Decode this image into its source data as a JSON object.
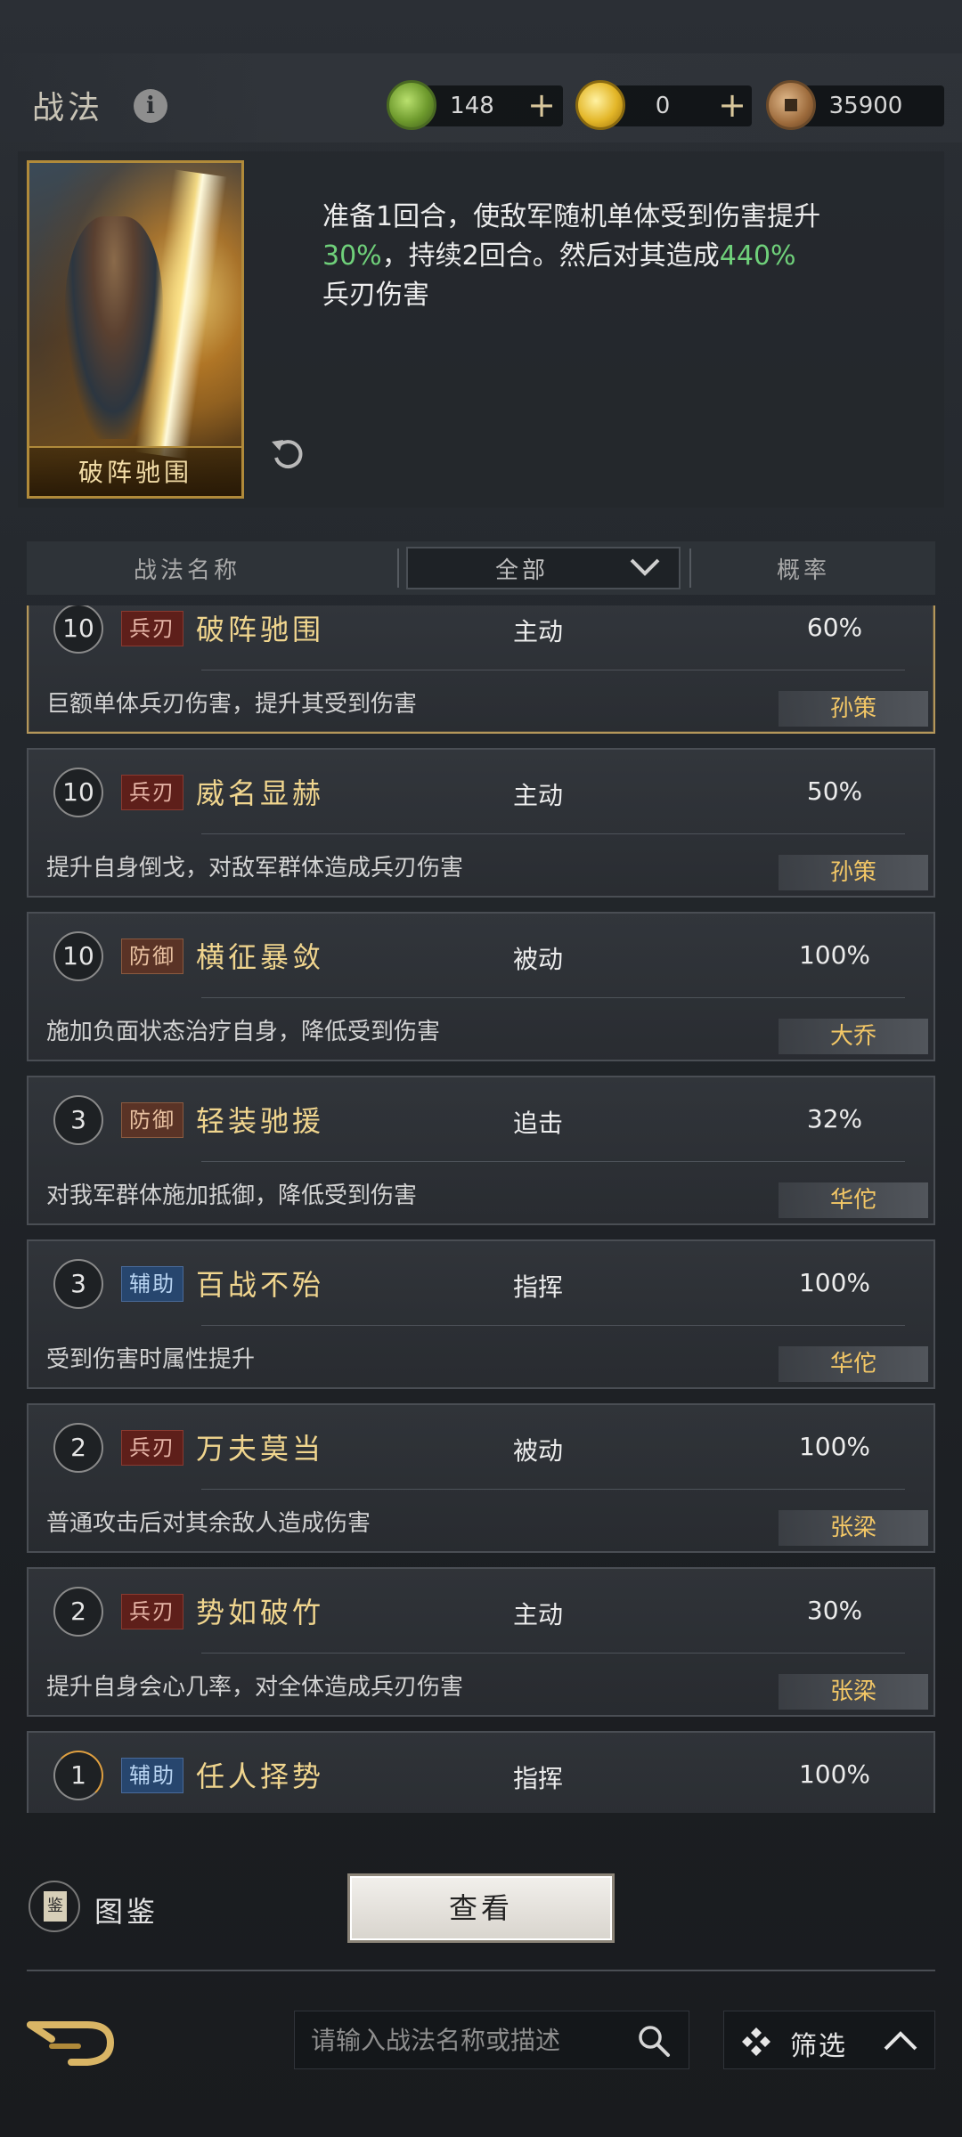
{
  "header": {
    "title": "战法",
    "resources": [
      {
        "icon": "jade-icon",
        "value": "148"
      },
      {
        "icon": "gold-ingot-icon",
        "value": "0"
      },
      {
        "icon": "copper-coin-icon",
        "value": "35900"
      }
    ],
    "plus": "+"
  },
  "preview": {
    "card_name": "破阵驰围",
    "desc_part1": "准备1回合，使敌军随机单体受到伤害提升",
    "desc_hl1": "30%",
    "desc_part2": "，持续2回合。然后对其造成",
    "desc_hl2": "440%",
    "desc_part3": "兵刃伤害"
  },
  "list_header": {
    "name_col": "战法名称",
    "filter_value": "全部",
    "rate_col": "概率"
  },
  "skills": [
    {
      "level": "10",
      "tag": "兵刃",
      "name": "破阵驰围",
      "type": "主动",
      "rate": "60%",
      "desc": "巨额单体兵刃伤害，提升其受到伤害",
      "owner": "孙策"
    },
    {
      "level": "10",
      "tag": "兵刃",
      "name": "威名显赫",
      "type": "主动",
      "rate": "50%",
      "desc": "提升自身倒戈，对敌军群体造成兵刃伤害",
      "owner": "孙策"
    },
    {
      "level": "10",
      "tag": "防御",
      "name": "横征暴敛",
      "type": "被动",
      "rate": "100%",
      "desc": "施加负面状态治疗自身，降低受到伤害",
      "owner": "大乔"
    },
    {
      "level": "3",
      "tag": "防御",
      "name": "轻装驰援",
      "type": "追击",
      "rate": "32%",
      "desc": "对我军群体施加抵御，降低受到伤害",
      "owner": "华佗"
    },
    {
      "level": "3",
      "tag": "辅助",
      "name": "百战不殆",
      "type": "指挥",
      "rate": "100%",
      "desc": "受到伤害时属性提升",
      "owner": "华佗"
    },
    {
      "level": "2",
      "tag": "兵刃",
      "name": "万夫莫当",
      "type": "被动",
      "rate": "100%",
      "desc": "普通攻击后对其余敌人造成伤害",
      "owner": "张梁"
    },
    {
      "level": "2",
      "tag": "兵刃",
      "name": "势如破竹",
      "type": "主动",
      "rate": "30%",
      "desc": "提升自身会心几率，对全体造成兵刃伤害",
      "owner": "张梁"
    },
    {
      "level": "1",
      "tag": "辅助",
      "name": "任人择势",
      "type": "指挥",
      "rate": "100%",
      "desc": "",
      "owner": ""
    }
  ],
  "bottom": {
    "atlas_icon_char": "鉴",
    "atlas_label": "图鉴",
    "view_button": "查看",
    "search_placeholder": "请输入战法名称或描述",
    "filter_label": "筛选"
  }
}
